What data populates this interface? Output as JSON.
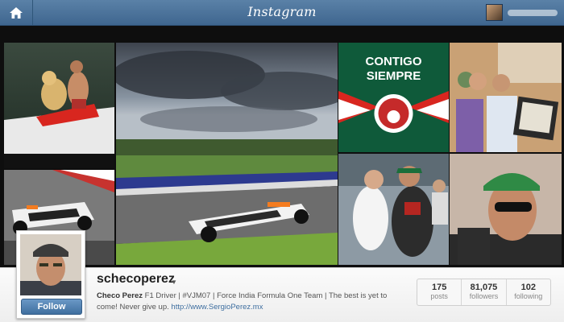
{
  "app": {
    "brand": "Instagram"
  },
  "header": {
    "home_icon": "home-icon"
  },
  "photos": [
    {
      "alt": "Checo on a jet ski with a dog"
    },
    {
      "alt": "Stormy sky over the race track"
    },
    {
      "alt": "Contigo Siempre Mexico crest",
      "text_line1": "CONTIGO",
      "text_line2": "SIEMPRE"
    },
    {
      "alt": "Two men holding a framed picture on a plane"
    },
    {
      "alt": "Force India F1 car on track"
    },
    {
      "alt": "Force India car close up"
    },
    {
      "alt": "Checo with a fan in the paddock"
    },
    {
      "alt": "Checo portrait with cap and sunglasses"
    }
  ],
  "profile": {
    "username": "schecoperez",
    "caret": "▼",
    "bio_name": "Checo Perez",
    "bio_text": " F1 Driver | #VJM07 | Force India Formula One Team | The best is yet to come! Never give up. ",
    "bio_link": "http://www.SergioPerez.mx",
    "follow_label": "Follow",
    "stats": [
      {
        "value": "175",
        "label": "posts"
      },
      {
        "value": "81,075",
        "label": "followers"
      },
      {
        "value": "102",
        "label": "following"
      }
    ]
  }
}
